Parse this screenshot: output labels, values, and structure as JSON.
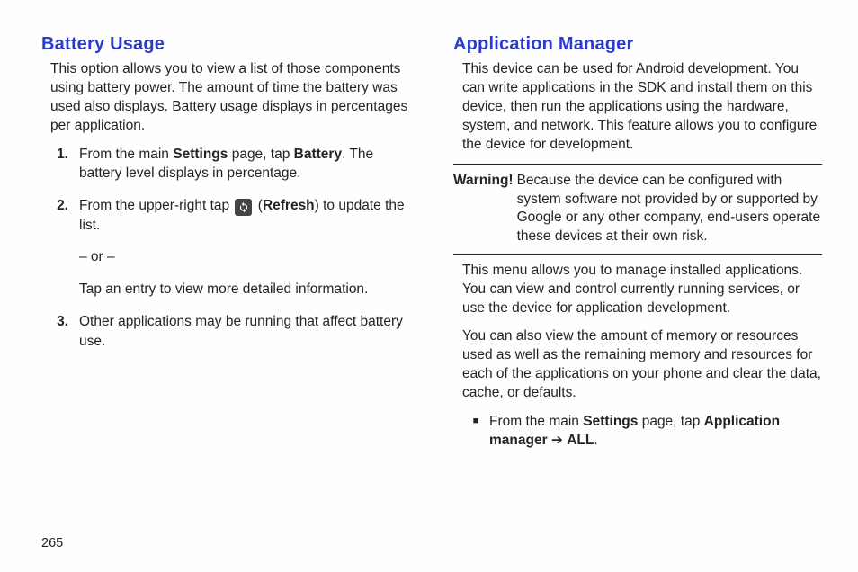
{
  "page_number": "265",
  "left": {
    "heading": "Battery Usage",
    "intro": "This option allows you to view a list of those components using battery power. The amount of time the battery was used also displays. Battery usage displays in percentages per application.",
    "step1_a": "From the main ",
    "step1_b": "Settings",
    "step1_c": " page, tap ",
    "step1_d": "Battery",
    "step1_e": ". The battery level displays in percentage.",
    "step2_a": "From the upper-right tap ",
    "step2_b": " (",
    "step2_c": "Refresh",
    "step2_d": ") to update the list.",
    "step2_or": "– or –",
    "step2_sub": "Tap an entry to view more detailed information.",
    "step3": "Other applications may be running that affect battery use.",
    "n1": "1.",
    "n2": "2.",
    "n3": "3."
  },
  "right": {
    "heading": "Application Manager",
    "intro": "This device can be used for Android development. You can write applications in the SDK and install them on this device, then run the applications using the hardware, system, and network. This feature allows you to configure the device for development.",
    "warning_label": "Warning!",
    "warning_text": "Because the device can be configured with system software not provided by or supported by Google or any other company, end-users operate these devices at their own risk.",
    "p2": "This menu allows you to manage installed applications. You can view and control currently running services, or use the device for application development.",
    "p3": "You can also view the amount of memory or resources used as well as the remaining memory and resources for each of the applications on your phone and clear the data, cache, or defaults.",
    "bullet_a": "From the main ",
    "bullet_b": "Settings",
    "bullet_c": " page, tap ",
    "bullet_d": "Application manager",
    "bullet_e": " ➔ ",
    "bullet_f": "ALL",
    "bullet_g": "."
  }
}
